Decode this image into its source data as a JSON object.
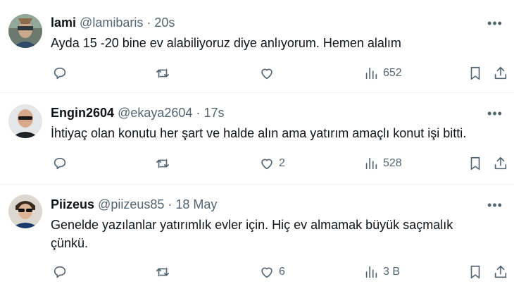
{
  "tweets": [
    {
      "name": "lami",
      "handle": "@lamibaris",
      "sep": "·",
      "time": "20s",
      "text": "Ayda 15 -20 bine ev alabiliyoruz diye anlıyorum. Hemen alalım",
      "replies": "",
      "retweets": "",
      "likes": "",
      "views": "652",
      "more": "•••"
    },
    {
      "name": "Engin2604",
      "handle": "@ekaya2604",
      "sep": "·",
      "time": "17s",
      "text": "İhtiyaç olan konutu her şart ve halde alın ama yatırım amaçlı konut işi bitti.",
      "replies": "",
      "retweets": "",
      "likes": "2",
      "views": "528",
      "more": "•••"
    },
    {
      "name": "Piizeus",
      "handle": "@piizeus85",
      "sep": "·",
      "time": "18 May",
      "text": "Genelde yazılanlar yatırımlık evler için. Hiç ev almamak büyük saçmalık\nçünkü.",
      "replies": "",
      "retweets": "",
      "likes": "6",
      "views": "3 B",
      "more": "•••"
    }
  ],
  "icons": [
    "reply-icon",
    "retweet-icon",
    "like-icon",
    "views-icon",
    "bookmark-icon",
    "share-icon",
    "more-icon"
  ],
  "colors": {
    "text": "#0f1419",
    "secondary": "#536471",
    "divider": "#eff3f4"
  }
}
